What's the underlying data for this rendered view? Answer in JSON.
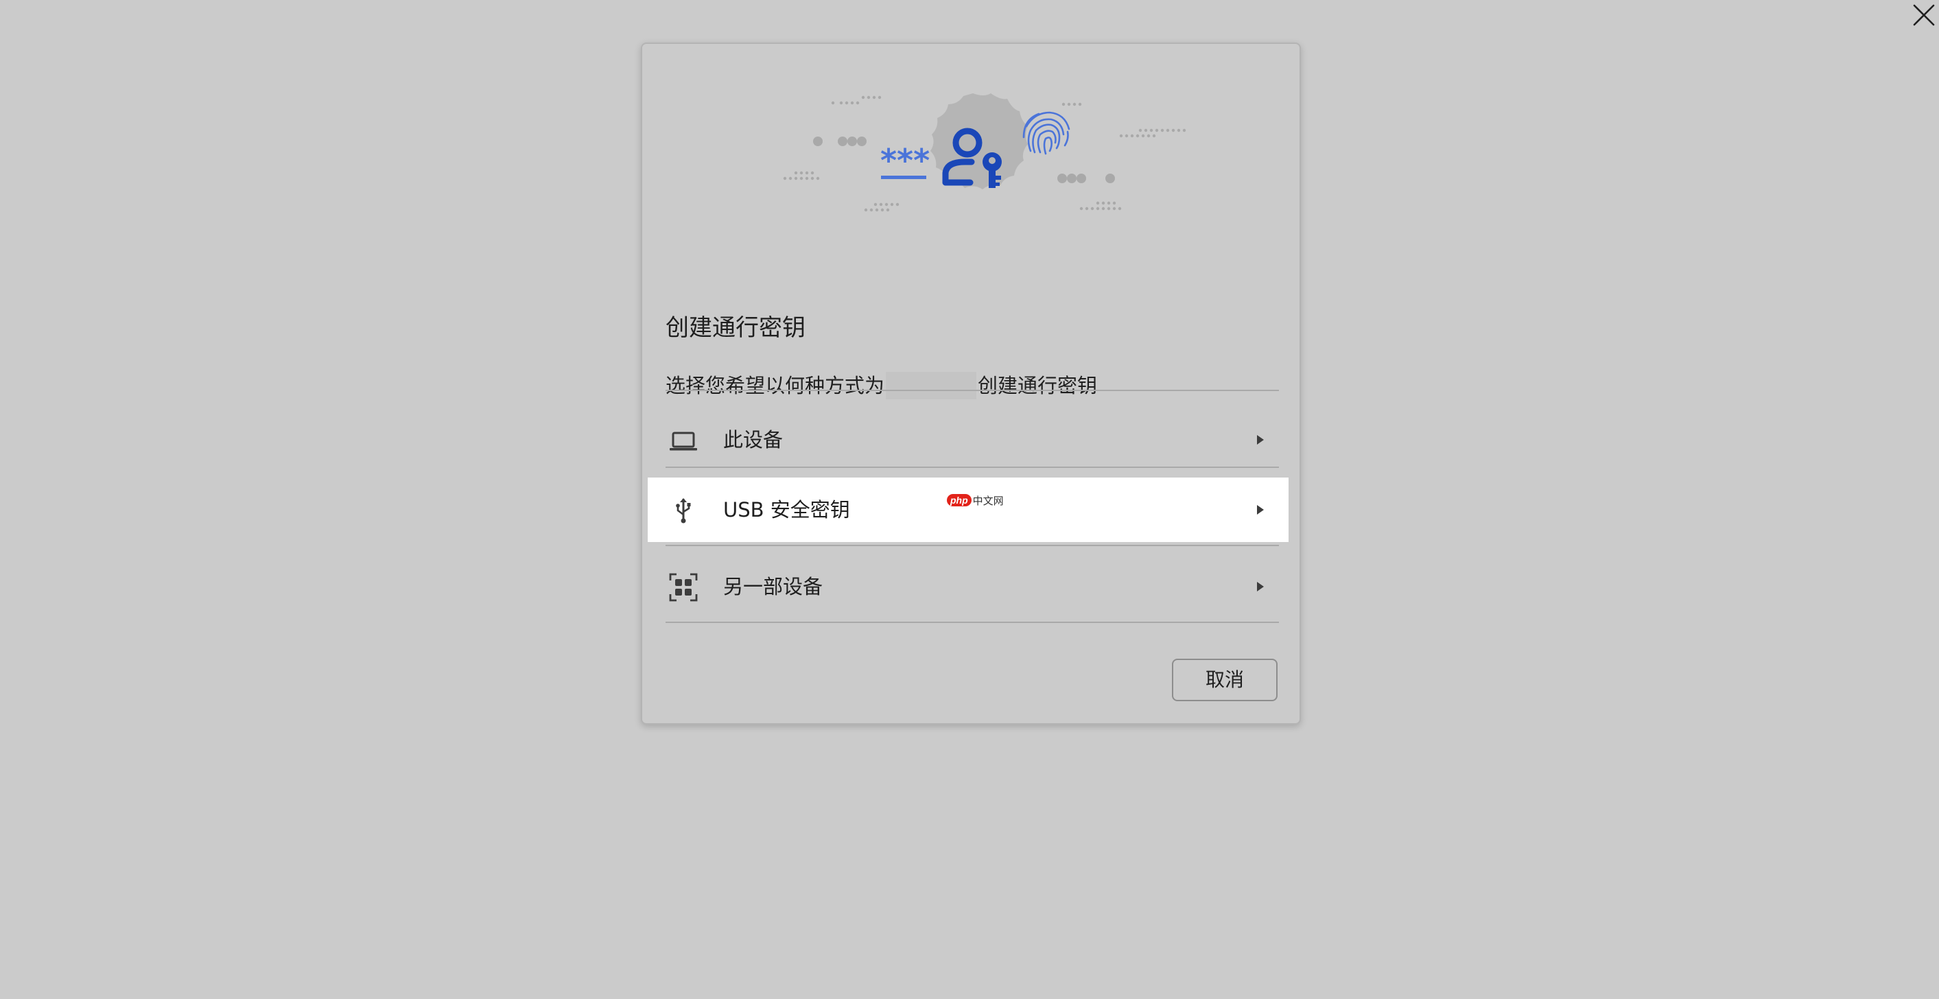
{
  "dialog": {
    "title": "创建通行密钥",
    "subtitle_before": "选择您希望以何种方式为",
    "subtitle_after": "创建通行密钥",
    "hero_masked_password": "***"
  },
  "options": [
    {
      "label": "此设备",
      "icon": "laptop-icon",
      "highlighted": false
    },
    {
      "label": "USB 安全密钥",
      "icon": "usb-icon",
      "highlighted": true
    },
    {
      "label": "另一部设备",
      "icon": "qr-code-icon",
      "highlighted": false
    }
  ],
  "watermark": {
    "logo": "php",
    "text": "中文网"
  },
  "buttons": {
    "cancel_label": "取消"
  },
  "colors": {
    "overlay_bg": "#cbcbcb",
    "accent_blue": "#1a4fc4",
    "highlight_row": "#ffffff",
    "watermark_red": "#e2231a"
  }
}
